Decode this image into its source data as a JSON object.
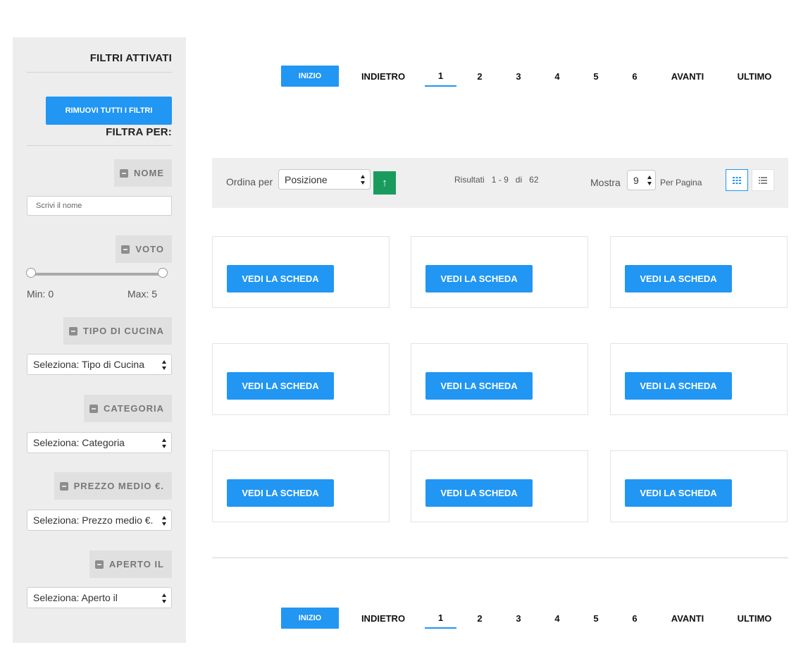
{
  "sidebar": {
    "active_filters_title": "FILTRI ATTIVATI",
    "remove_all_label": "RIMUOVI TUTTI I FILTRI",
    "filter_by_title": "FILTRA PER:",
    "name_filter": {
      "label": "NOME",
      "placeholder": "Scrivi il nome"
    },
    "rating_filter": {
      "label": "VOTO",
      "min_label": "Min: 0",
      "max_label": "Max: 5",
      "min_value": 0,
      "max_value": 5
    },
    "cuisine_filter": {
      "label": "TIPO DI CUCINA",
      "selected": "Seleziona: Tipo di Cucina"
    },
    "category_filter": {
      "label": "CATEGORIA",
      "selected": "Seleziona: Categoria"
    },
    "price_filter": {
      "label": "PREZZO MEDIO €.",
      "selected": "Seleziona: Prezzo medio €."
    },
    "open_filter": {
      "label": "APERTO IL",
      "selected": "Seleziona: Aperto il"
    }
  },
  "pagination": {
    "start": "INIZIO",
    "prev": "INDIETRO",
    "pages": [
      "1",
      "2",
      "3",
      "4",
      "5",
      "6"
    ],
    "active_page": "1",
    "next": "AVANTI",
    "last": "ULTIMO"
  },
  "toolbar": {
    "sort_label": "Ordina per",
    "sort_selected": "Posizione",
    "sort_dir_icon": "↑",
    "results_label": "Risultati",
    "results_from": "1",
    "results_sep": "-",
    "results_to": "9",
    "results_of": "di",
    "results_total": "62",
    "show_label": "Mostra",
    "limit_selected": "9",
    "per_page_label": "Per Pagina"
  },
  "cards": [
    {
      "button": "VEDI LA SCHEDA"
    },
    {
      "button": "VEDI LA SCHEDA"
    },
    {
      "button": "VEDI LA SCHEDA"
    },
    {
      "button": "VEDI LA SCHEDA"
    },
    {
      "button": "VEDI LA SCHEDA"
    },
    {
      "button": "VEDI LA SCHEDA"
    },
    {
      "button": "VEDI LA SCHEDA"
    },
    {
      "button": "VEDI LA SCHEDA"
    },
    {
      "button": "VEDI LA SCHEDA"
    }
  ],
  "colors": {
    "accent": "#2196f3",
    "sort_button": "#1a9b5e",
    "sidebar_bg": "#ededed",
    "toolbar_bg": "#efefef"
  }
}
